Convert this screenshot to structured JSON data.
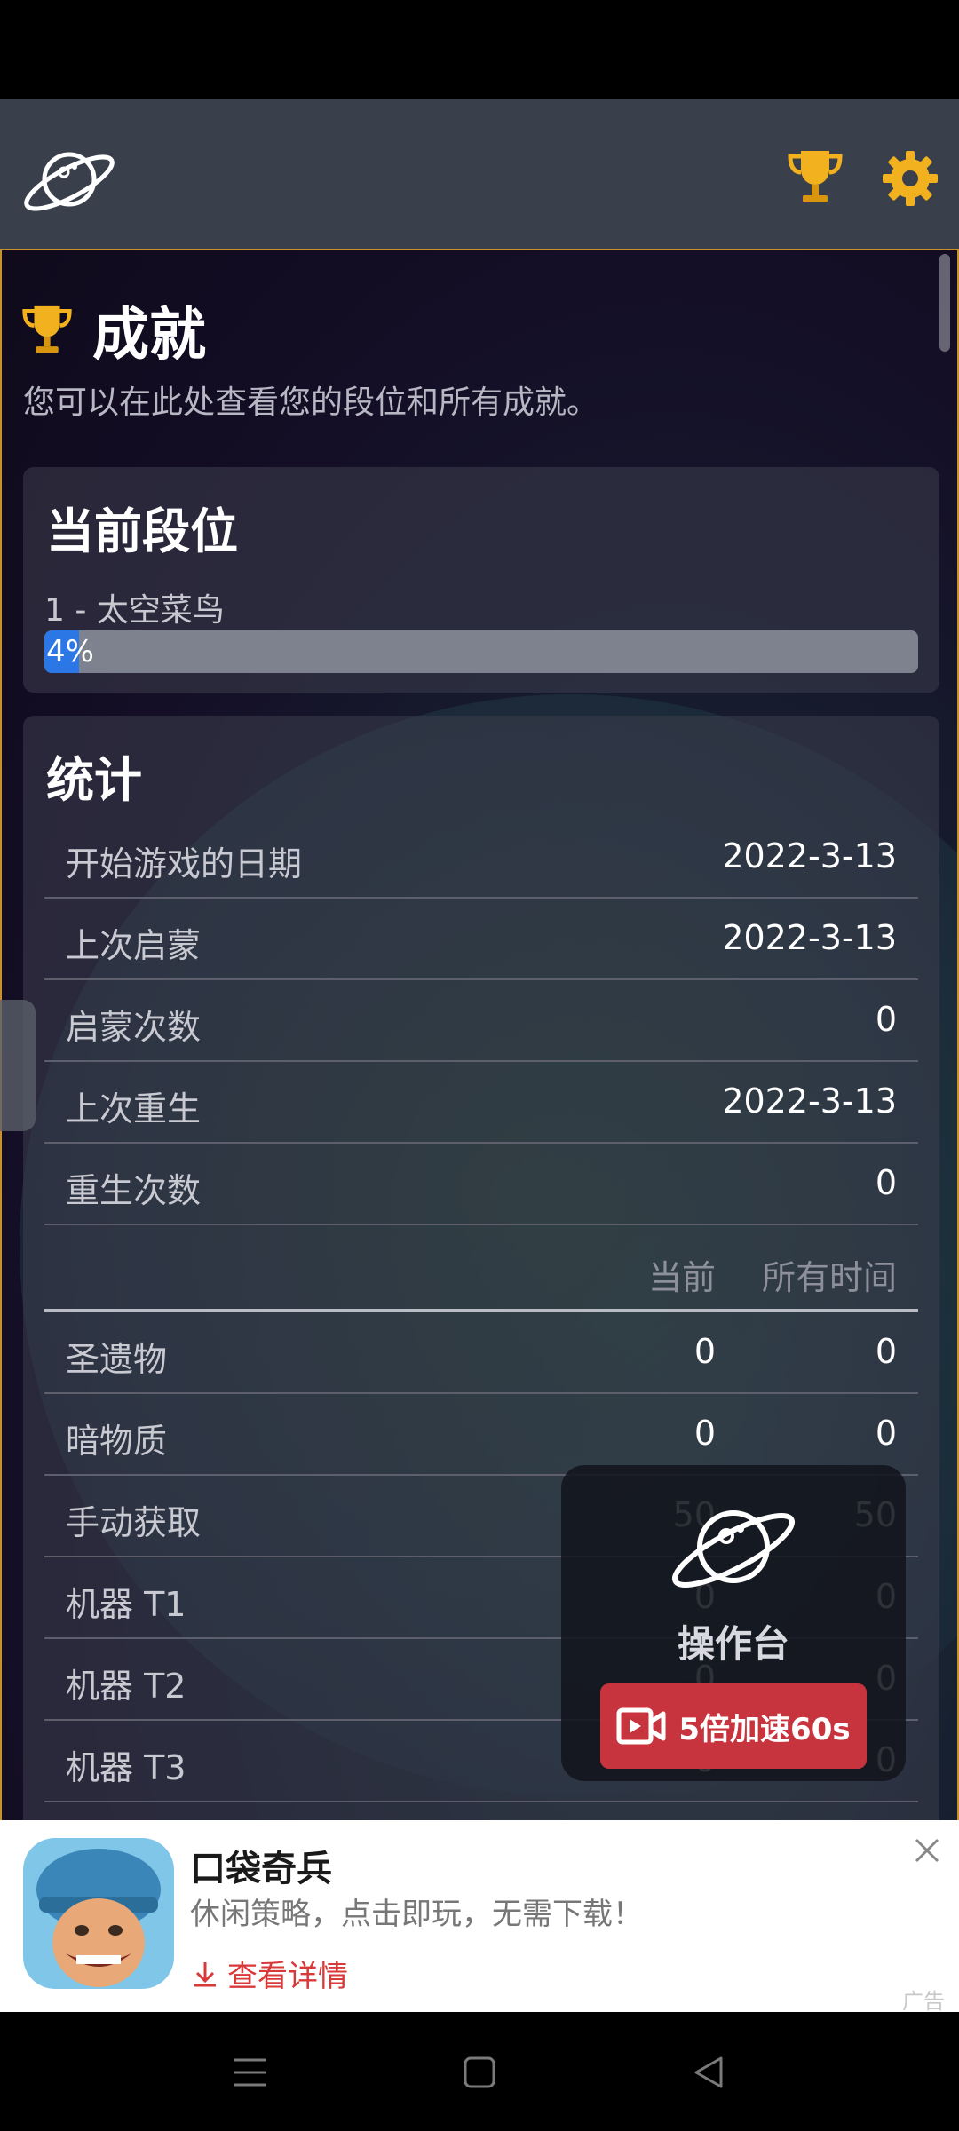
{
  "header": {
    "logo_icon": "planet-icon",
    "trophy_icon": "trophy-icon",
    "settings_icon": "gear-icon"
  },
  "page": {
    "title": "成就",
    "subtitle": "您可以在此处查看您的段位和所有成就。"
  },
  "rank": {
    "heading": "当前段位",
    "name": "1 - 太空菜鸟",
    "progress": 0.04,
    "progress_label": "4%"
  },
  "stats": {
    "heading": "统计",
    "general": [
      {
        "label": "开始游戏的日期",
        "value": "2022-3-13"
      },
      {
        "label": "上次启蒙",
        "value": "2022-3-13"
      },
      {
        "label": "启蒙次数",
        "value": "0"
      },
      {
        "label": "上次重生",
        "value": "2022-3-13"
      },
      {
        "label": "重生次数",
        "value": "0"
      }
    ],
    "columns": [
      "当前",
      "所有时间"
    ],
    "items": [
      {
        "label": "圣遗物",
        "current": "0",
        "all_time": "0"
      },
      {
        "label": "暗物质",
        "current": "0",
        "all_time": "0"
      },
      {
        "label": "手动获取",
        "current": "50",
        "all_time": "50"
      },
      {
        "label": "机器 T1",
        "current": "0",
        "all_time": "0"
      },
      {
        "label": "机器 T2",
        "current": "0",
        "all_time": "0"
      },
      {
        "label": "机器 T3",
        "current": "0",
        "all_time": "0"
      }
    ]
  },
  "console": {
    "label": "操作台",
    "button": "5倍加速60s"
  },
  "ad": {
    "title": "口袋奇兵",
    "description": "休闲策略，点击即玩，无需下载！",
    "link": "查看详情",
    "tag": "广告"
  },
  "colors": {
    "accent_border": "#c8922a",
    "progress_fill": "#2b77e6",
    "speed_button": "#c8343d"
  }
}
